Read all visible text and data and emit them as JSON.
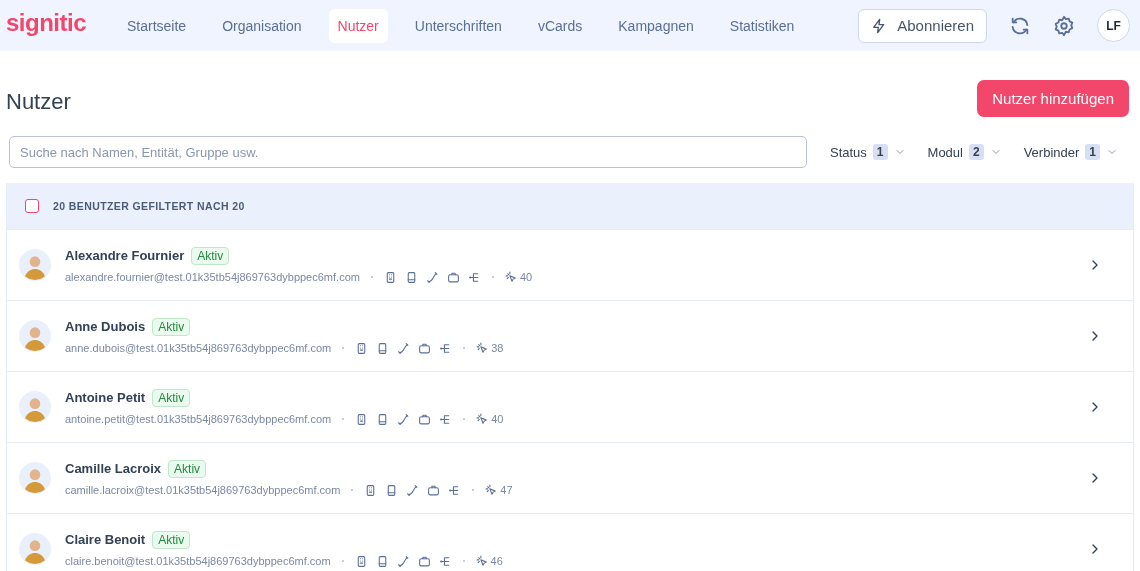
{
  "brand": "signitic",
  "nav": [
    {
      "label": "Startseite",
      "selected": false
    },
    {
      "label": "Organisation",
      "selected": false
    },
    {
      "label": "Nutzer",
      "selected": true
    },
    {
      "label": "Unterschriften",
      "selected": false
    },
    {
      "label": "vCards",
      "selected": false
    },
    {
      "label": "Kampagnen",
      "selected": false
    },
    {
      "label": "Statistiken",
      "selected": false
    }
  ],
  "subscribe_button": "Abonnieren",
  "avatar_initials": "LF",
  "page_title": "Nutzer",
  "add_button": "Nutzer hinzufügen",
  "search": {
    "placeholder": "Suche nach Namen, Entität, Gruppe usw."
  },
  "filters": [
    {
      "label": "Status",
      "count": "1"
    },
    {
      "label": "Modul",
      "count": "2"
    },
    {
      "label": "Verbinder",
      "count": "1"
    }
  ],
  "table": {
    "select_all_checked": false,
    "summary": "20 BENUTZER GEFILTERT NACH 20",
    "rows": [
      {
        "name": "Alexandre Fournier",
        "status": "Aktiv",
        "email": "alexandre.fournier@test.01k35tb54j869763dybppec6mf.com",
        "clicks": "40"
      },
      {
        "name": "Anne Dubois",
        "status": "Aktiv",
        "email": "anne.dubois@test.01k35tb54j869763dybppec6mf.com",
        "clicks": "38"
      },
      {
        "name": "Antoine Petit",
        "status": "Aktiv",
        "email": "antoine.petit@test.01k35tb54j869763dybppec6mf.com",
        "clicks": "40"
      },
      {
        "name": "Camille Lacroix",
        "status": "Aktiv",
        "email": "camille.lacroix@test.01k35tb54j869763dybppec6mf.com",
        "clicks": "47"
      },
      {
        "name": "Claire Benoit",
        "status": "Aktiv",
        "email": "claire.benoit@test.01k35tb54j869763dybppec6mf.com",
        "clicks": "46"
      }
    ]
  }
}
